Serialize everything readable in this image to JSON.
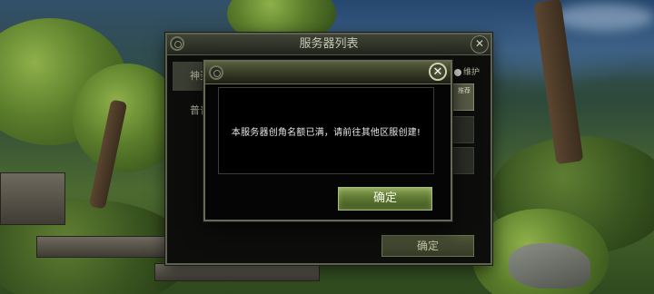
{
  "server_list": {
    "title": "服务器列表",
    "tabs": [
      "神圣",
      "普普"
    ],
    "maintenance_label": "维护",
    "hint_label": "推荐",
    "confirm_label": "确定"
  },
  "notice_dialog": {
    "message": "本服务器创角名额已满，请前往其他区服创建!",
    "confirm_label": "确定",
    "close_glyph": "✕"
  },
  "colors": {
    "dialog_button": "#6f8a3f",
    "panel_border": "#656a57",
    "panel_bg": "#050505"
  }
}
